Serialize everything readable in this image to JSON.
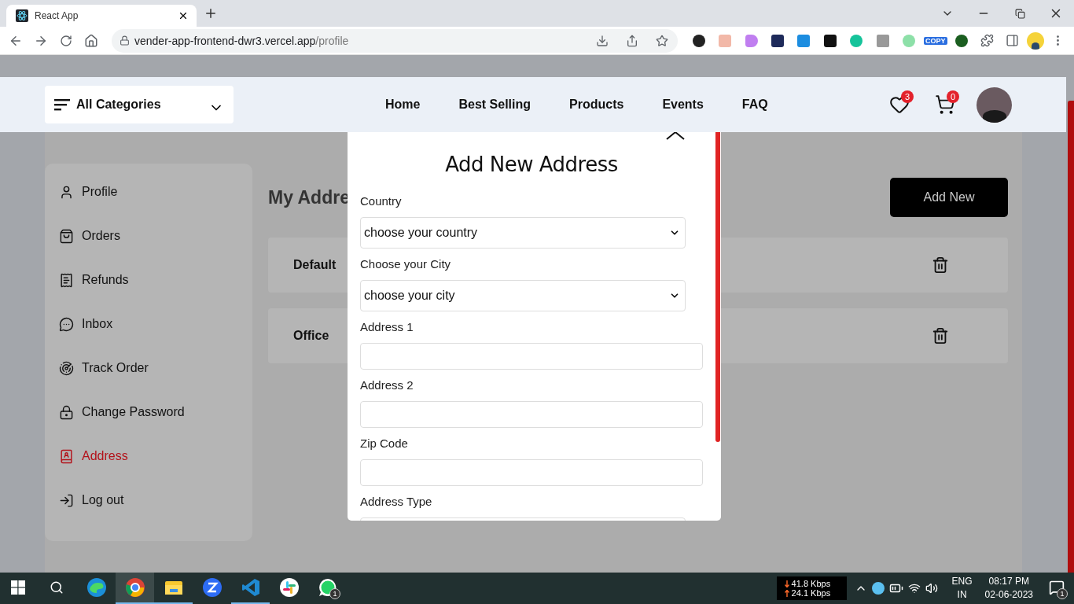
{
  "browser": {
    "tab_title": "React App",
    "url_host": "vender-app-frontend-dwr3.vercel.app",
    "url_path": "/profile",
    "extension_badge": "COPY"
  },
  "header": {
    "categories": "All Categories",
    "nav": [
      {
        "label": "Home"
      },
      {
        "label": "Best Selling"
      },
      {
        "label": "Products"
      },
      {
        "label": "Events"
      },
      {
        "label": "FAQ"
      }
    ],
    "wishlist_count": "3",
    "cart_count": "0"
  },
  "sidebar": {
    "items": [
      {
        "label": "Profile",
        "kind": "user",
        "selected": false
      },
      {
        "label": "Orders",
        "kind": "bag",
        "selected": false
      },
      {
        "label": "Refunds",
        "kind": "receipt",
        "selected": false
      },
      {
        "label": "Inbox",
        "kind": "chat",
        "selected": false
      },
      {
        "label": "Track Order",
        "kind": "track",
        "selected": false
      },
      {
        "label": "Change Password",
        "kind": "lock",
        "selected": false
      },
      {
        "label": "Address",
        "kind": "address",
        "selected": true
      },
      {
        "label": "Log out",
        "kind": "logout",
        "selected": false
      }
    ]
  },
  "main": {
    "title": "My Addre",
    "add_button": "Add New",
    "addresses": [
      {
        "type": "Default"
      },
      {
        "type": "Office"
      }
    ]
  },
  "modal": {
    "title": "Add New Address",
    "fields": [
      {
        "kind": "select",
        "label": "Country",
        "value": "choose your country"
      },
      {
        "kind": "select",
        "label": "Choose your City",
        "value": "choose your city"
      },
      {
        "kind": "input",
        "label": "Address 1"
      },
      {
        "kind": "input",
        "label": "Address 2"
      },
      {
        "kind": "input",
        "label": "Zip Code"
      },
      {
        "kind": "select",
        "label": "Address Type"
      }
    ]
  },
  "taskbar": {
    "apps": [
      {
        "kind": "edge",
        "open": false,
        "selected": false
      },
      {
        "kind": "chrome",
        "open": true,
        "selected": true
      },
      {
        "kind": "explorer",
        "open": true,
        "selected": false
      },
      {
        "kind": "zoom",
        "open": false,
        "selected": false
      },
      {
        "kind": "vscode",
        "open": true,
        "selected": false
      },
      {
        "kind": "slack",
        "open": false,
        "selected": false
      },
      {
        "kind": "whatsapp",
        "open": false,
        "selected": false,
        "badge": "1"
      }
    ],
    "download_speed": "41.8 Kbps",
    "upload_speed": "24.1 Kbps",
    "language": "ENG",
    "region": "IN",
    "time": "08:17 PM",
    "date": "02-06-2023",
    "notifications": "1"
  }
}
